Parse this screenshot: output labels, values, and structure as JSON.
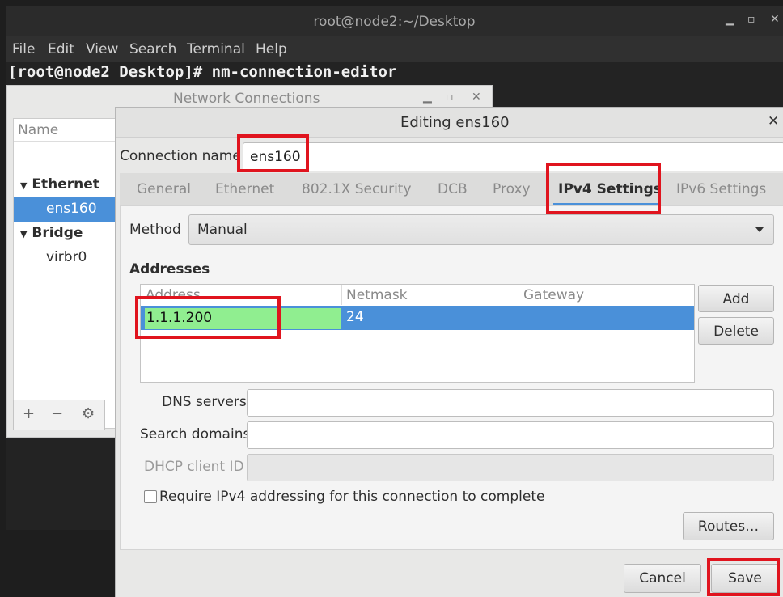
{
  "terminal": {
    "title": "root@node2:~/Desktop",
    "menu": [
      "File",
      "Edit",
      "View",
      "Search",
      "Terminal",
      "Help"
    ],
    "prompt": "[root@node2 Desktop]# nm-connection-editor"
  },
  "network_connections": {
    "title": "Network Connections",
    "column_header": "Name",
    "groups": [
      {
        "label": "Ethernet",
        "items": [
          "ens160"
        ]
      },
      {
        "label": "Bridge",
        "items": [
          "virbr0"
        ]
      }
    ],
    "selected_item": "ens160",
    "toolbar": {
      "add": "+",
      "remove": "−",
      "settings": "⚙"
    }
  },
  "dialog": {
    "title": "Editing ens160",
    "connection_name_label": "Connection name",
    "connection_name_value": "ens160",
    "tabs": [
      "General",
      "Ethernet",
      "802.1X Security",
      "DCB",
      "Proxy",
      "IPv4 Settings",
      "IPv6 Settings"
    ],
    "active_tab": "IPv4 Settings",
    "method_label": "Method",
    "method_value": "Manual",
    "addresses_label": "Addresses",
    "columns": [
      "Address",
      "Netmask",
      "Gateway"
    ],
    "rows": [
      {
        "address": "1.1.1.200",
        "netmask": "24",
        "gateway": ""
      }
    ],
    "add_button": "Add",
    "delete_button": "Delete",
    "dns_label": "DNS servers",
    "search_label": "Search domains",
    "dhcp_label": "DHCP client ID",
    "require_label": "Require IPv4 addressing for this connection to complete",
    "routes_button": "Routes…",
    "cancel_button": "Cancel",
    "save_button": "Save"
  }
}
